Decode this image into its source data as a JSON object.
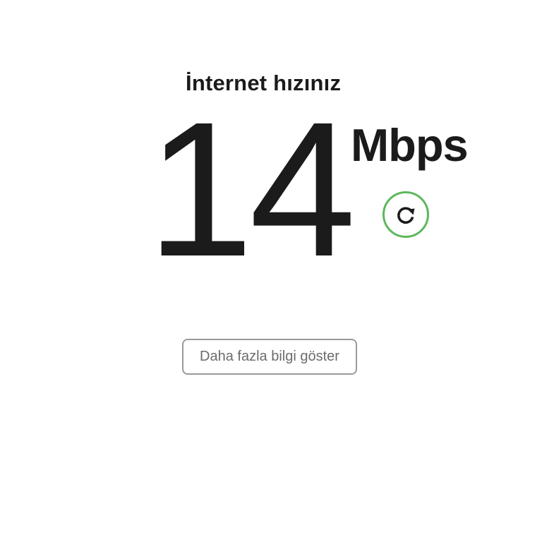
{
  "header": {
    "title": "İnternet hızınız"
  },
  "speed": {
    "value": "14",
    "unit": "Mbps"
  },
  "actions": {
    "refresh_icon": "refresh-icon",
    "more_info_label": "Daha fazla bilgi göster"
  },
  "colors": {
    "text": "#1b1b1b",
    "accent": "#5cb85c",
    "button_border": "#9a9a9a",
    "button_text": "#6c6c6c"
  }
}
